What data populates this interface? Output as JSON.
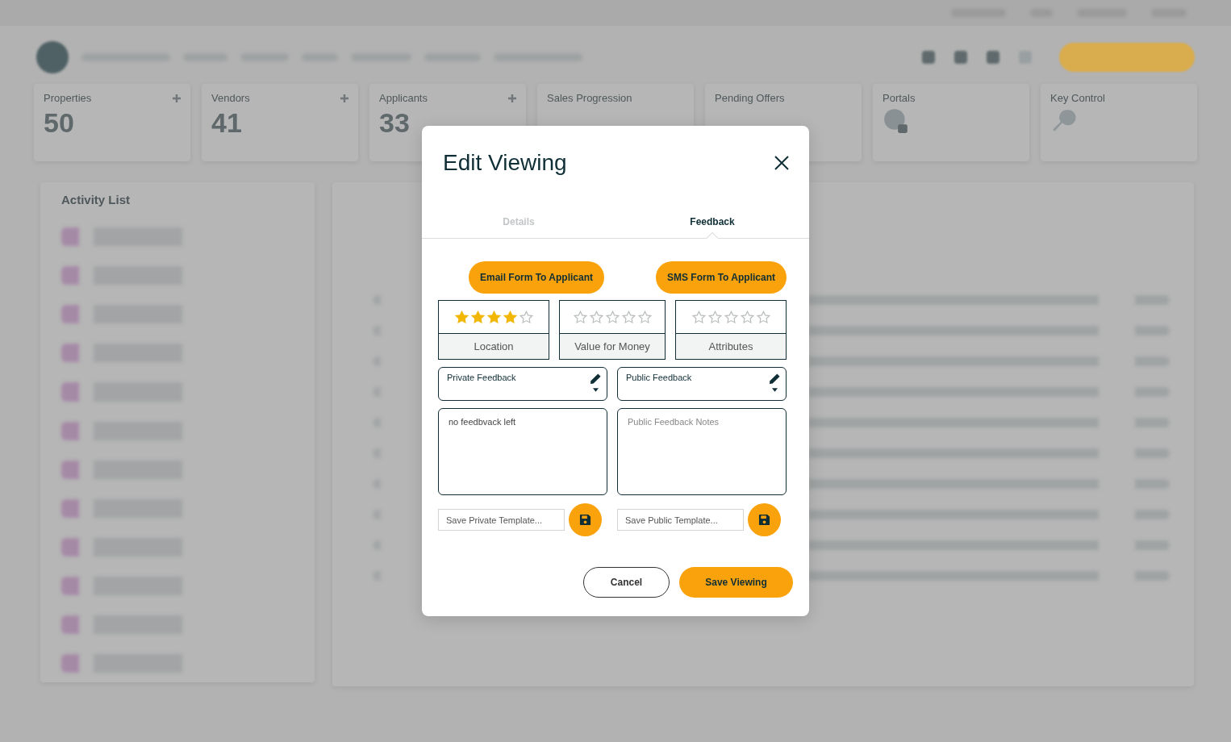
{
  "backdrop": {
    "stat_cards": [
      {
        "label": "Properties",
        "value": "50",
        "kind": "count"
      },
      {
        "label": "Vendors",
        "value": "41",
        "kind": "count"
      },
      {
        "label": "Applicants",
        "value": "33",
        "kind": "count"
      },
      {
        "label": "Sales Progression",
        "kind": "count"
      },
      {
        "label": "Pending Offers",
        "kind": "count"
      },
      {
        "label": "Portals",
        "kind": "globe"
      },
      {
        "label": "Key Control",
        "kind": "key"
      }
    ],
    "activity_list": {
      "title": "Activity List"
    }
  },
  "dialog": {
    "title": "Edit Viewing",
    "tabs": [
      {
        "label": "Details",
        "selected": false
      },
      {
        "label": "Feedback",
        "selected": true
      }
    ],
    "send_buttons": [
      "Email Form To Applicant",
      "SMS Form To Applicant"
    ],
    "ratings": [
      {
        "label": "Location",
        "stars": 4
      },
      {
        "label": "Value for Money",
        "stars": 0
      },
      {
        "label": "Attributes",
        "stars": 0
      }
    ],
    "feedback": [
      {
        "dropdown": "Private Feedback",
        "notes": {
          "value": "no feedbvack left"
        },
        "template": {
          "placeholder": "Save Private Template..."
        }
      },
      {
        "dropdown": "Public Feedback",
        "notes": {
          "placeholder": "Public Feedback Notes"
        },
        "template": {
          "placeholder": "Save Public Template..."
        }
      }
    ],
    "cancel": "Cancel",
    "save": "Save Viewing"
  }
}
